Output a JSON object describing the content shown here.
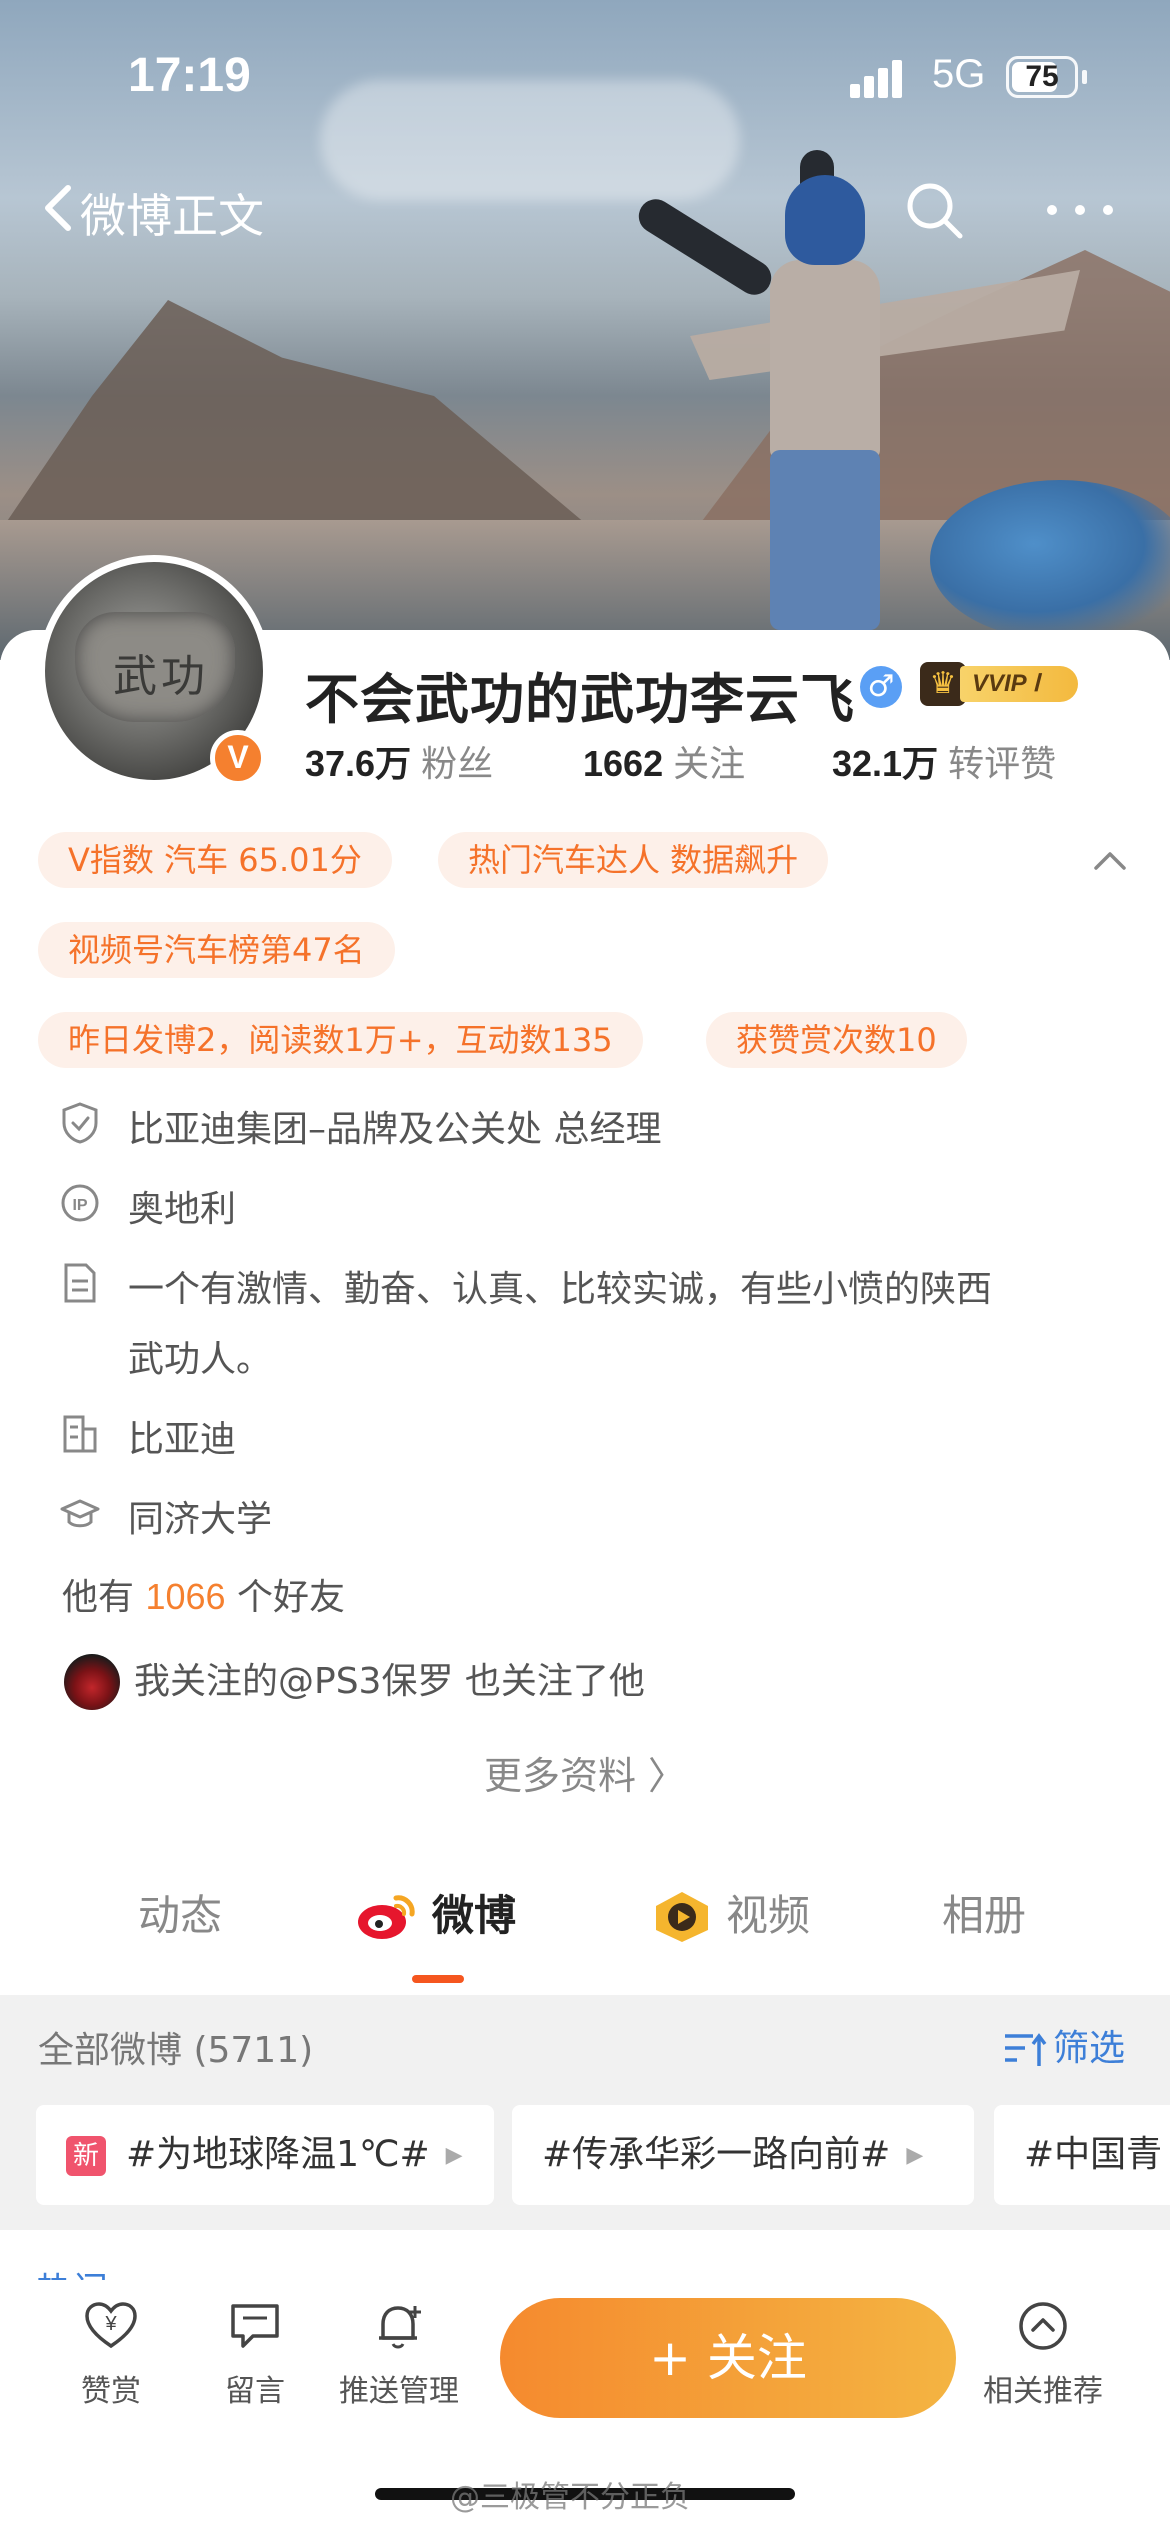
{
  "status_bar": {
    "time": "17:19",
    "network": "5G",
    "battery": "75",
    "battery_level": 0.75
  },
  "nav": {
    "back_label": "微博正文"
  },
  "profile": {
    "name": "不会武功的武功李云飞",
    "gender_symbol": "♂",
    "vvip_label": "VVIP Ⅰ",
    "verified_badge": "V",
    "avatar_text": "武功",
    "stats": [
      {
        "value": "37.6万",
        "label": "粉丝"
      },
      {
        "value": "1662",
        "label": "关注"
      },
      {
        "value": "32.1万",
        "label": "转评赞"
      }
    ],
    "tags": [
      "V指数 汽车 65.01分",
      "热门汽车达人 数据飙升",
      "视频号汽车榜第47名",
      "昨日发博2，阅读数1万+，互动数135",
      "获赞赏次数10"
    ],
    "info": {
      "verification": "比亚迪集团–品牌及公关处  总经理",
      "ip": "奥地利",
      "bio_line1": "一个有激情、勤奋、认真、比较实诚，有些小愤的陕西",
      "bio_line2": "武功人。",
      "company": "比亚迪",
      "school": "同济大学"
    },
    "friends": {
      "prefix": "他有",
      "count": "1066",
      "suffix": "个好友"
    },
    "mutual": "我关注的@PS3保罗  也关注了他",
    "more_info": "更多资料 〉"
  },
  "tabs": [
    {
      "label": "动态"
    },
    {
      "label": "微博"
    },
    {
      "label": "视频"
    },
    {
      "label": "相册"
    }
  ],
  "feed": {
    "all_label": "全部微博 (5711)",
    "filter_label": "筛选",
    "new_badge": "新",
    "topics": [
      "#为地球降温1℃#",
      "#传承华彩一路向前#",
      "#中国青"
    ],
    "next_section_label": "热门"
  },
  "toolbar": {
    "reward": "赞赏",
    "message": "留言",
    "push": "推送管理",
    "follow": "+ 关注",
    "recommend": "相关推荐"
  },
  "watermark": "@三极管不分正负",
  "colors": {
    "accent": "#f5802f",
    "chip_bg": "#fdf0e9",
    "link_blue": "#3d7fd8",
    "follow_start": "#f58a2e",
    "follow_end": "#f4b442"
  }
}
